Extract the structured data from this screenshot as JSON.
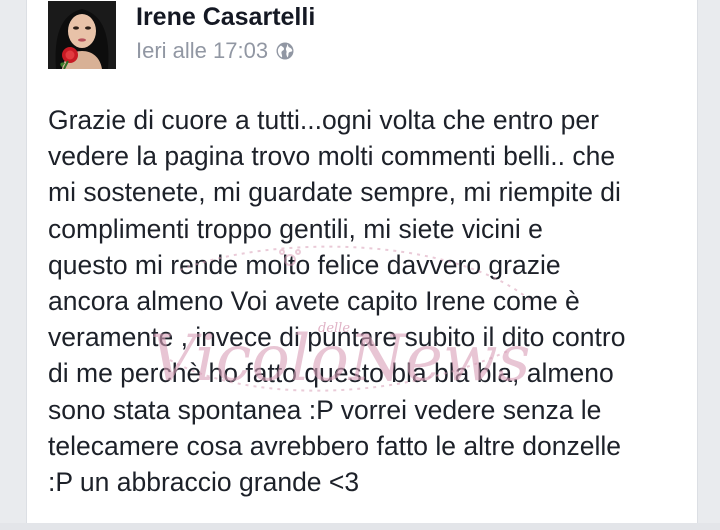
{
  "post": {
    "author": "Irene Casartelli",
    "timestamp": "Ieri alle 17:03",
    "privacy_icon": "globe-icon",
    "body": "Grazie di cuore  a tutti...ogni volta che entro per\nvedere la pagina trovo molti commenti belli.. che\nmi sostenete, mi guardate sempre, mi riempite di\ncomplimenti troppo gentili, mi siete vicini e\nquesto mi rende molto felice davvero grazie\nancora almeno Voi avete capito Irene come è\nveramente , invece di puntare subito il dito contro\ndi me perchè ho fatto questo bla bla bla, almeno\nsono stata spontanea :P vorrei vedere senza le\ntelecamere cosa avrebbero fatto le altre donzelle\n:P un abbraccio grande <3"
  },
  "watermark": {
    "small_text": "delle",
    "main_text": "VicoloNews",
    "color": "#d9a0b8"
  },
  "colors": {
    "name": "#141823",
    "meta": "#9197a3",
    "text": "#1d2129",
    "background": "#e9ebee"
  }
}
